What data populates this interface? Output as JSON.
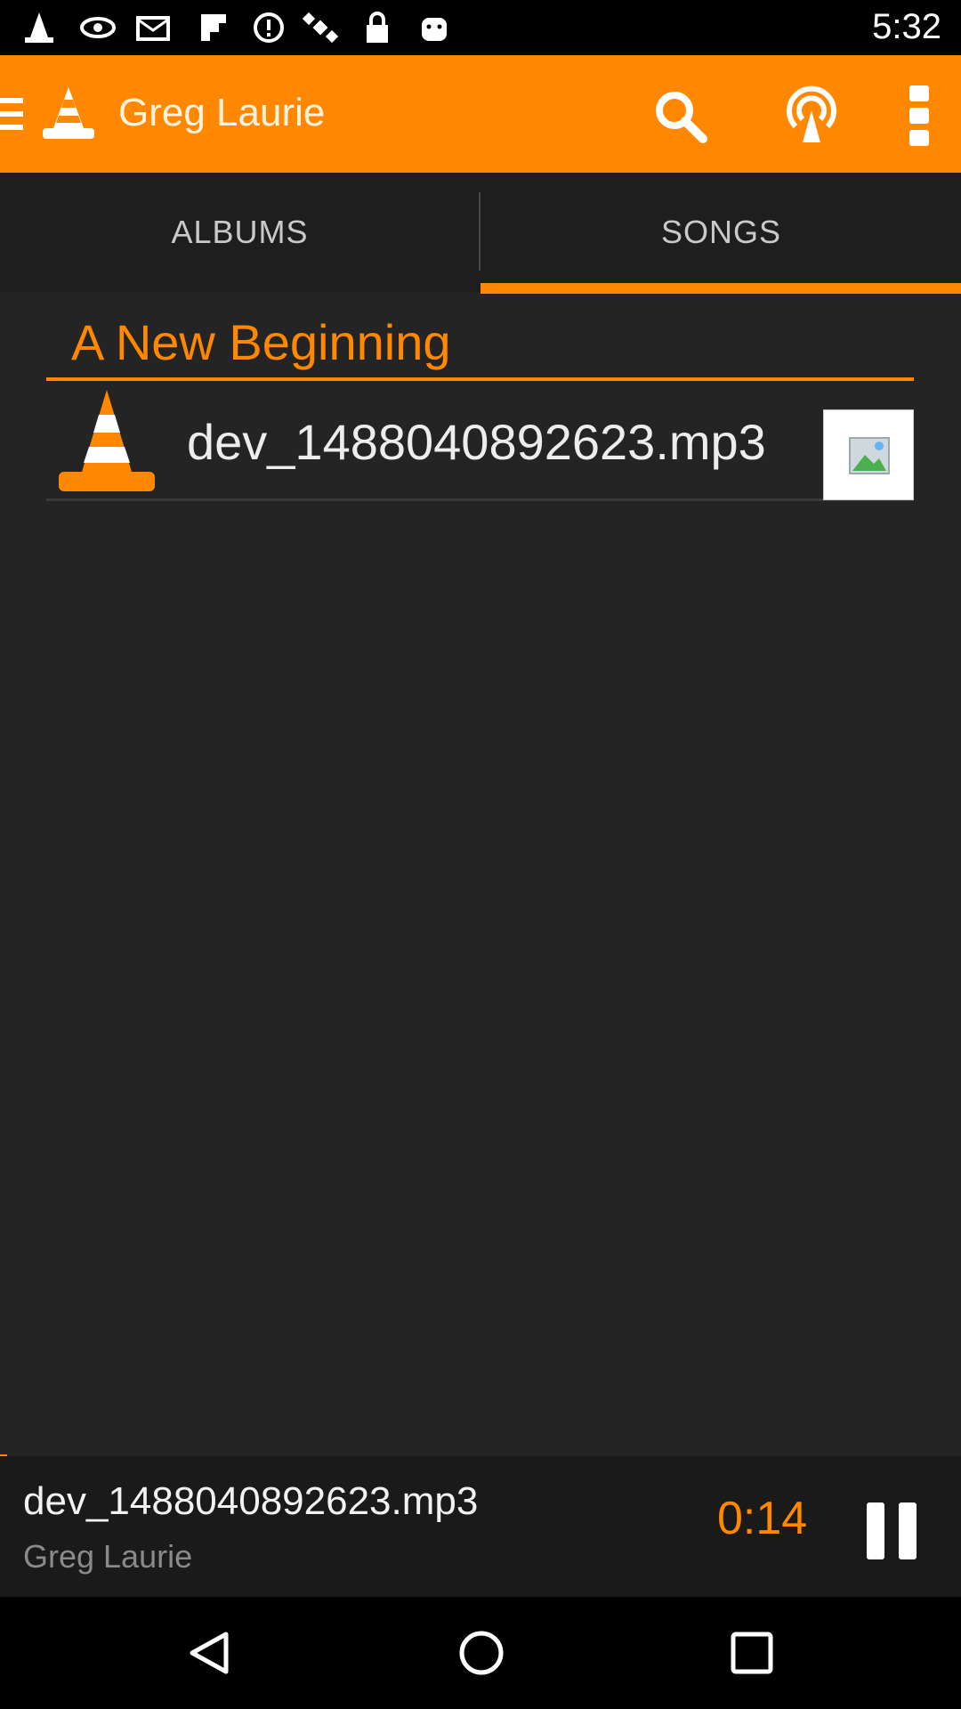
{
  "status_bar": {
    "time": "5:32",
    "icons": [
      "vlc-cone-icon",
      "eye-icon",
      "mail-icon",
      "flipboard-icon",
      "info-icon",
      "satellite-icon",
      "lock-icon",
      "android-icon"
    ]
  },
  "app_bar": {
    "title": "Greg Laurie",
    "icons": [
      "menu-icon",
      "vlc-cone-icon",
      "search-icon",
      "cast-icon",
      "overflow-menu-icon"
    ]
  },
  "tabs": [
    {
      "label": "ALBUMS",
      "selected": false
    },
    {
      "label": "SONGS",
      "selected": true
    }
  ],
  "album_list": {
    "album_title": "A New Beginning",
    "songs": [
      {
        "name": "dev_1488040892623.mp3"
      }
    ]
  },
  "mini_player": {
    "title": "dev_1488040892623.mp3",
    "artist": "Greg Laurie",
    "time": "0:14",
    "progress_fraction": 0.007
  },
  "colors": {
    "accent": "#ff8800",
    "background": "#242424",
    "text_primary": "#ededed",
    "text_secondary": "#8a8a8a"
  }
}
